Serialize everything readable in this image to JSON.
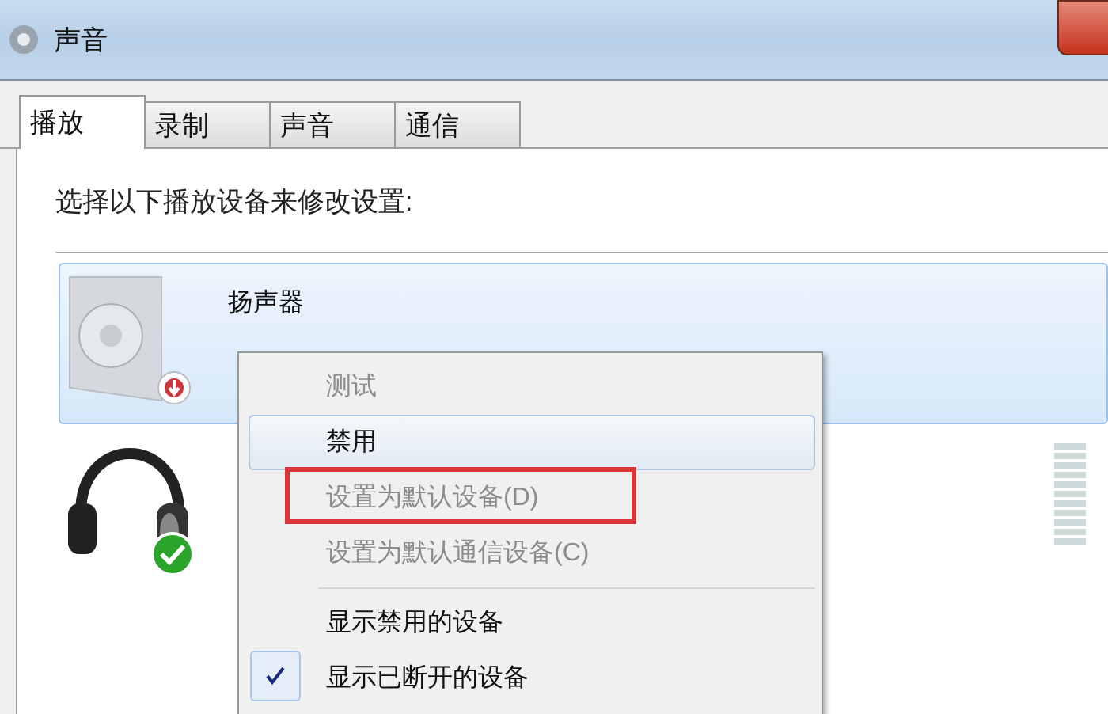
{
  "window": {
    "title": "声音"
  },
  "tabs": [
    {
      "label": "播放",
      "selected": true
    },
    {
      "label": "录制",
      "selected": false
    },
    {
      "label": "声音",
      "selected": false
    },
    {
      "label": "通信",
      "selected": false
    }
  ],
  "instruction": "选择以下播放设备来修改设置:",
  "devices": [
    {
      "name": "扬声器",
      "kind": "speaker",
      "selected": true
    },
    {
      "kind": "headphones",
      "selected": false,
      "level": 0
    }
  ],
  "context_menu": [
    {
      "label": "测试",
      "disabled": true,
      "hovered": false,
      "checked": false,
      "marked": false
    },
    {
      "label": "禁用",
      "disabled": false,
      "hovered": true,
      "checked": false,
      "marked": false
    },
    {
      "label": "设置为默认设备(D)",
      "disabled": true,
      "hovered": false,
      "checked": false,
      "marked": true
    },
    {
      "label": "设置为默认通信设备(C)",
      "disabled": true,
      "hovered": false,
      "checked": false,
      "marked": false,
      "separator_after": true
    },
    {
      "label": "显示禁用的设备",
      "disabled": false,
      "hovered": false,
      "checked": false,
      "marked": false
    },
    {
      "label": "显示已断开的设备",
      "disabled": false,
      "hovered": false,
      "checked": true,
      "marked": false
    }
  ]
}
